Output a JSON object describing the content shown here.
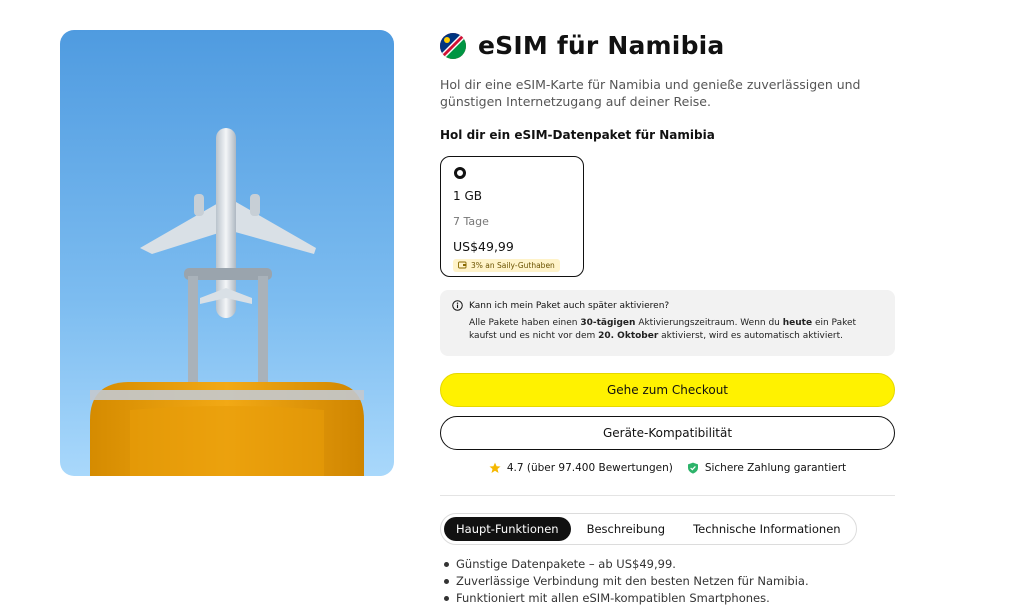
{
  "product": {
    "title": "eSIM für Namibia",
    "intro": "Hol dir eine eSIM-Karte für Namibia und genieße zuverlässigen und günstigen Internetzugang auf deiner Reise.",
    "flag_icon": "namibia-flag-icon"
  },
  "packages": {
    "heading": "Hol dir ein eSIM-Datenpaket für Namibia",
    "items": [
      {
        "size": "1 GB",
        "duration": "7 Tage",
        "price": "US$49,99",
        "badge": "3% an Saily-Guthaben",
        "selected": true
      }
    ]
  },
  "info": {
    "question": "Kann ich mein Paket auch später aktivieren?",
    "answer_parts": {
      "p1": "Alle Pakete haben einen ",
      "b1": "30-tägigen",
      "p2": " Aktivierungszeitraum. Wenn du ",
      "b2": "heute",
      "p3": " ein Paket kaufst und es nicht vor dem ",
      "b3": "20. Oktober",
      "p4": " aktivierst, wird es automatisch aktiviert."
    }
  },
  "actions": {
    "checkout": "Gehe zum Checkout",
    "compatibility": "Geräte-Kompatibilität"
  },
  "trust": {
    "rating": "4.7 (über 97.400 Bewertungen)",
    "secure": "Sichere Zahlung garantiert"
  },
  "tabs": [
    {
      "label": "Haupt-Funktionen",
      "active": true
    },
    {
      "label": "Beschreibung",
      "active": false
    },
    {
      "label": "Technische Informationen",
      "active": false
    }
  ],
  "features": [
    "Günstige Datenpakete – ab US$49,99.",
    "Zuverlässige Verbindung mit den besten Netzen für Namibia.",
    "Funktioniert mit allen eSIM-kompatiblen Smartphones."
  ],
  "colors": {
    "accent_yellow": "#fff200",
    "dark": "#111111",
    "star": "#f5b800",
    "shield": "#2db36a"
  }
}
